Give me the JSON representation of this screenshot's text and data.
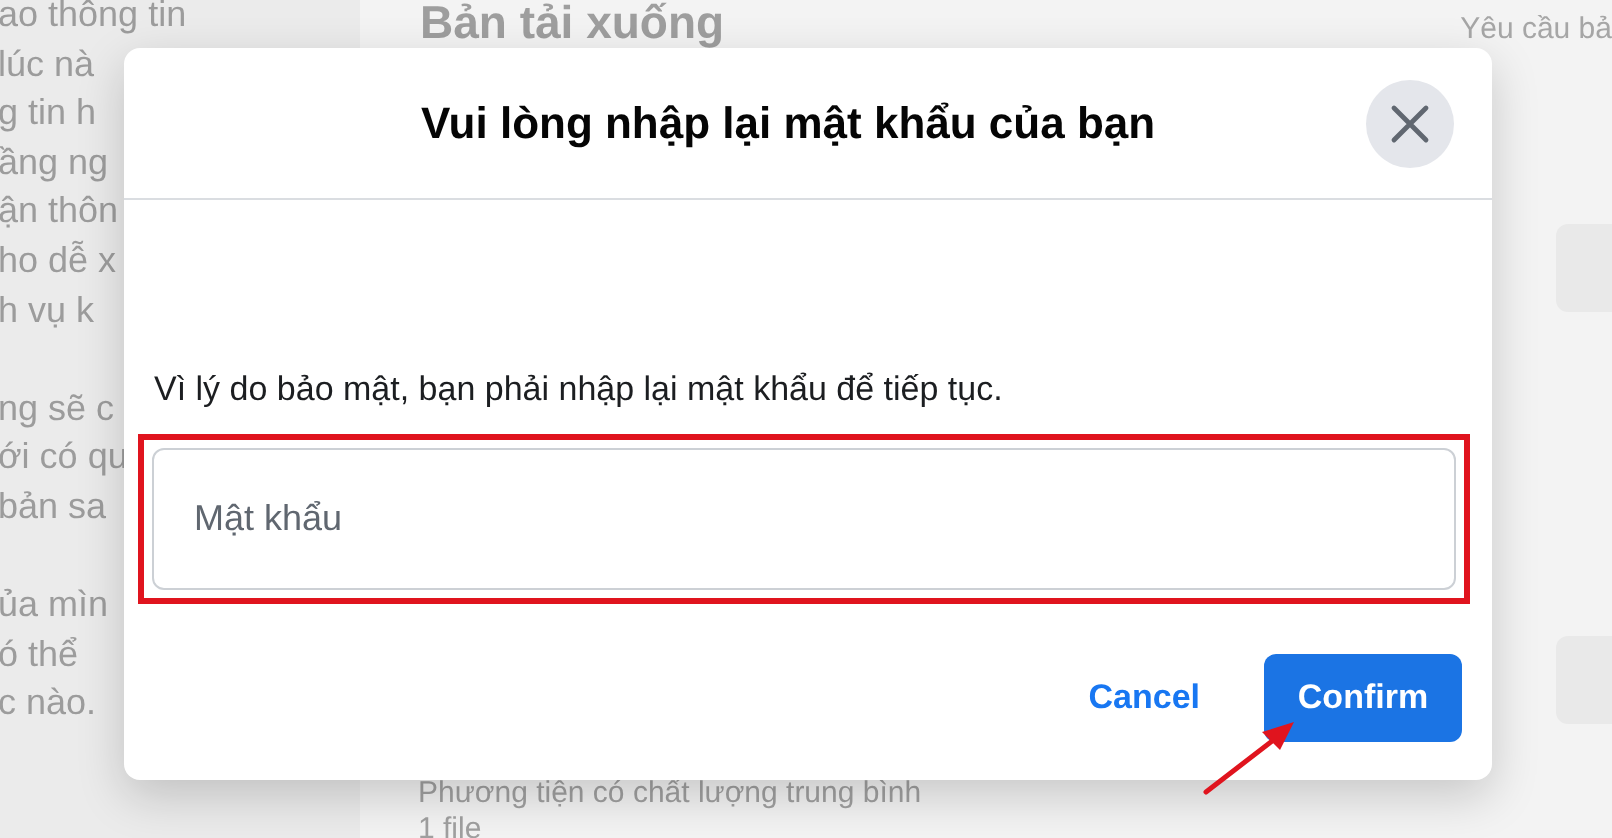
{
  "background": {
    "sidebar_paragraphs": [
      [
        "ao thông tin",
        "lúc nà",
        "g tin h",
        "ầng ng",
        "ận thôn",
        "ho dễ x",
        "h vụ k"
      ],
      [
        "ng sẽ c",
        "ới có qu",
        "bản sa"
      ],
      [
        "ủa mìn",
        "ó thể",
        "c nào."
      ]
    ],
    "heading": "Bản tải xuống",
    "header_link": "Yêu cầu bả",
    "item_title": "Phương tiện có chất lượng trung bình",
    "item_subtitle": "1 file"
  },
  "dialog": {
    "title": "Vui lòng nhập lại mật khẩu của bạn",
    "message": "Vì lý do bảo mật, bạn phải nhập lại mật khẩu để tiếp tục.",
    "password_field": {
      "placeholder": "Mật khẩu",
      "highlighted": true
    },
    "buttons": [
      {
        "label": "Cancel",
        "kind": "link"
      },
      {
        "label": "Confirm",
        "kind": "primary"
      }
    ]
  },
  "annotations": [
    {
      "kind": "arrow"
    }
  ]
}
